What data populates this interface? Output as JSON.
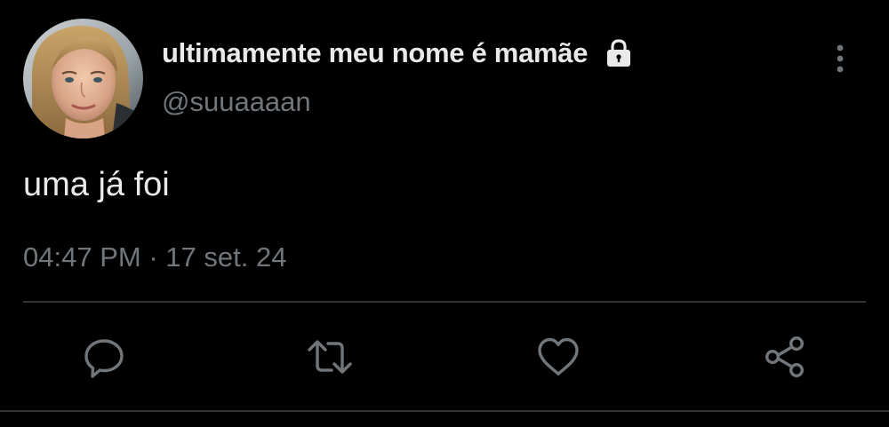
{
  "tweet": {
    "display_name": "ultimamente meu nome é mamãe",
    "handle": "@suuaaaan",
    "text": "uma já foi",
    "time": "04:47 PM",
    "separator": "·",
    "date": "17 set. 24",
    "protected": true
  },
  "icons": {
    "avatar": "profile-photo",
    "lock": "lock-icon",
    "more": "more-vertical-icon",
    "reply": "reply-icon",
    "retweet": "retweet-icon",
    "like": "like-heart-icon",
    "share": "share-icon"
  },
  "colors": {
    "background": "#000000",
    "primary_text": "#e7e9ea",
    "secondary_text": "#71767b",
    "divider": "#2f3336"
  }
}
